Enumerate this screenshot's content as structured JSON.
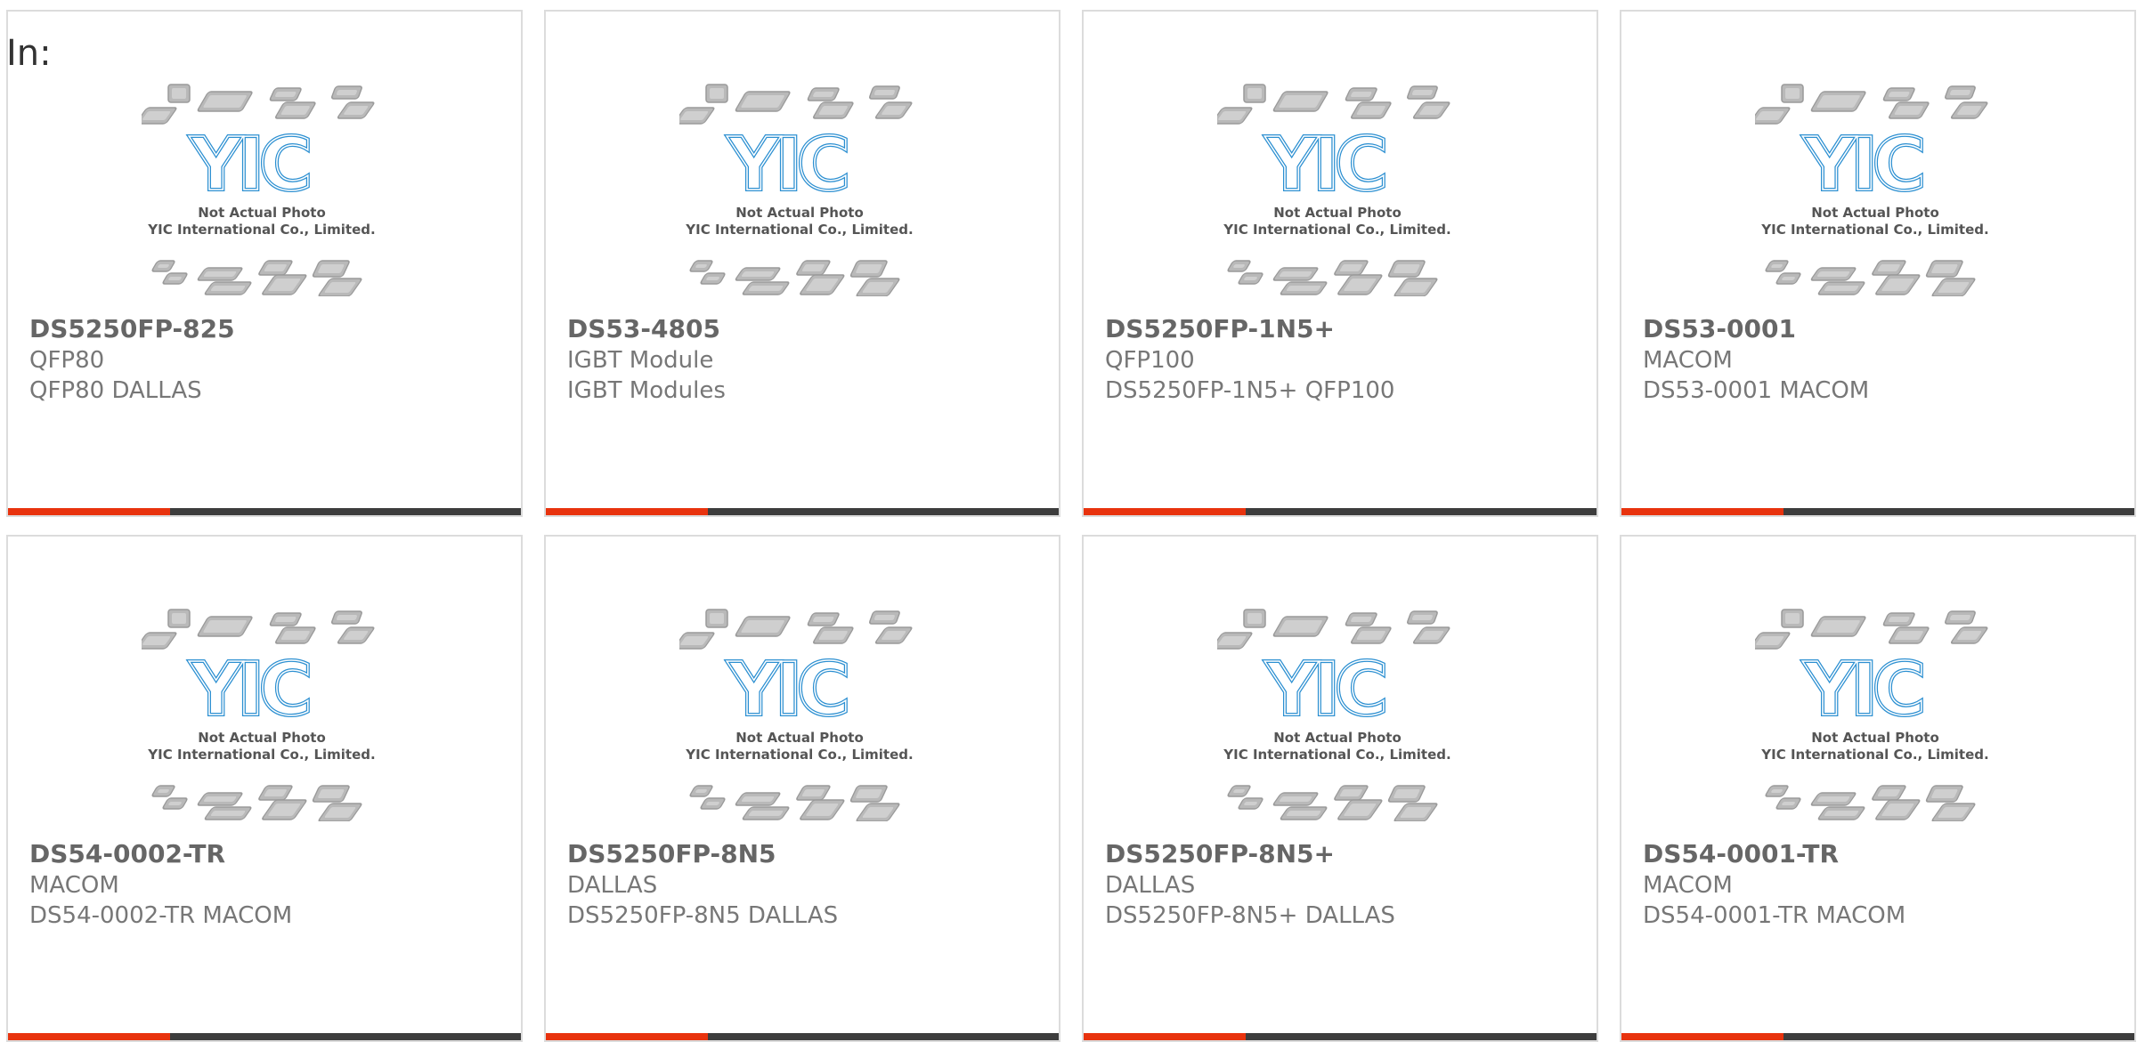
{
  "header": {
    "in_label": "In:"
  },
  "image": {
    "caption_line1": "Not Actual Photo",
    "caption_line2": "YIC International Co., Limited.",
    "logo_text": "YIC"
  },
  "colors": {
    "accent": "#e8330e",
    "bar": "#3d3d3d",
    "logo": "#2b8fd1",
    "border": "#dcdcdc"
  },
  "products": [
    {
      "part": "DS5250FP-825",
      "package": "QFP80",
      "desc": "QFP80 DALLAS"
    },
    {
      "part": "DS53-4805",
      "package": "IGBT Module",
      "desc": "IGBT Modules"
    },
    {
      "part": "DS5250FP-1N5+",
      "package": "QFP100",
      "desc": "DS5250FP-1N5+ QFP100"
    },
    {
      "part": "DS53-0001",
      "package": "MACOM",
      "desc": "DS53-0001 MACOM"
    },
    {
      "part": "DS54-0002-TR",
      "package": "MACOM",
      "desc": "DS54-0002-TR MACOM"
    },
    {
      "part": "DS5250FP-8N5",
      "package": "DALLAS",
      "desc": "DS5250FP-8N5 DALLAS"
    },
    {
      "part": "DS5250FP-8N5+",
      "package": "DALLAS",
      "desc": "DS5250FP-8N5+ DALLAS"
    },
    {
      "part": "DS54-0001-TR",
      "package": "MACOM",
      "desc": "DS54-0001-TR MACOM"
    }
  ]
}
